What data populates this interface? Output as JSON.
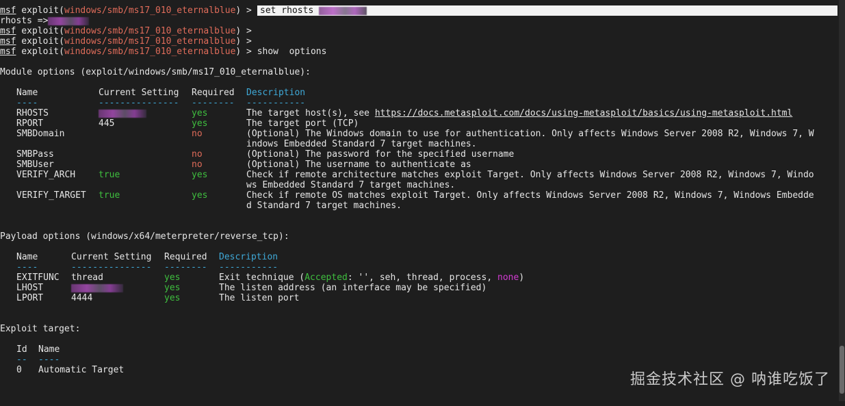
{
  "prompt": {
    "prefix": "msf",
    "module_open": " exploit(",
    "module": "windows/smb/ms17_010_eternalblue",
    "module_close": ") >",
    "current_input": "set rhosts"
  },
  "history": [
    {
      "left": "rhosts =>",
      "cmd": ""
    },
    {
      "cmd": ""
    },
    {
      "cmd": ""
    },
    {
      "cmd": " show  options"
    }
  ],
  "module_options": {
    "header": "Module options (exploit/windows/smb/ms17_010_eternalblue):",
    "columns": [
      "Name",
      "Current Setting",
      "Required",
      "Description"
    ],
    "underlines": [
      "----",
      "---------------",
      "--------",
      "-----------"
    ],
    "rows": [
      {
        "name": "RHOSTS",
        "setting": "",
        "required": "yes",
        "desc": [
          "The target host(s), see "
        ],
        "link": "https://docs.metasploit.com/docs/using-metasploit/basics/using-metasploit.html"
      },
      {
        "name": "RPORT",
        "setting": "445",
        "required": "yes",
        "desc": [
          "The target port (TCP)"
        ]
      },
      {
        "name": "SMBDomain",
        "setting": "",
        "required": "no",
        "desc": [
          "(Optional) The Windows domain to use for authentication. Only affects Windows Server 2008 R2, Windows 7, W",
          "indows Embedded Standard 7 target machines."
        ]
      },
      {
        "name": "SMBPass",
        "setting": "",
        "required": "no",
        "desc": [
          "(Optional) The password for the specified username"
        ]
      },
      {
        "name": "SMBUser",
        "setting": "",
        "required": "no",
        "desc": [
          "(Optional) The username to authenticate as"
        ]
      },
      {
        "name": "VERIFY_ARCH",
        "setting": "true",
        "required": "yes",
        "desc": [
          "Check if remote architecture matches exploit Target. Only affects Windows Server 2008 R2, Windows 7, Windo",
          "ws Embedded Standard 7 target machines."
        ]
      },
      {
        "name": "VERIFY_TARGET",
        "setting": "true",
        "required": "yes",
        "desc": [
          "Check if remote OS matches exploit Target. Only affects Windows Server 2008 R2, Windows 7, Windows Embedde",
          "d Standard 7 target machines."
        ]
      }
    ]
  },
  "payload_options": {
    "header": "Payload options (windows/x64/meterpreter/reverse_tcp):",
    "columns": [
      "Name",
      "Current Setting",
      "Required",
      "Description"
    ],
    "underlines": [
      "----",
      "---------------",
      "--------",
      "-----------"
    ],
    "rows": [
      {
        "name": "EXITFUNC",
        "setting": "thread",
        "required": "yes",
        "desc_a": "Exit technique (",
        "accepted": "Accepted",
        "desc_b": ": '', seh, thread, process, ",
        "none": "none",
        "desc_c": ")"
      },
      {
        "name": "LHOST",
        "setting": "",
        "required": "yes",
        "desc": "The listen address (an interface may be specified)"
      },
      {
        "name": "LPORT",
        "setting": "4444",
        "required": "yes",
        "desc": "The listen port"
      }
    ]
  },
  "exploit_target": {
    "header": "Exploit target:",
    "columns": [
      "Id",
      "Name"
    ],
    "underlines": [
      "--",
      "----"
    ],
    "rows": [
      {
        "id": "0",
        "name": "Automatic Target"
      }
    ]
  },
  "watermark": "掘金技术社区 @ 呐谁吃饭了",
  "colors": {
    "background": "#1e1e1e",
    "module_red": "#e06c5a",
    "required_yes": "#3fbf3f",
    "required_no": "#e06c5a",
    "description_cyan": "#3fa9d8",
    "none_magenta": "#d33bd3"
  }
}
